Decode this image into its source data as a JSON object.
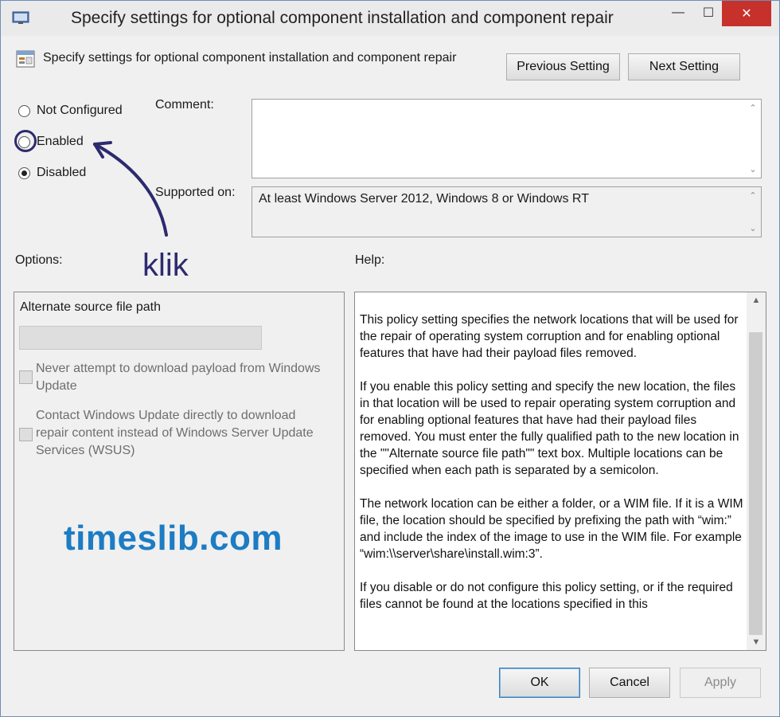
{
  "window": {
    "title": "Specify settings for optional component installation and component repair",
    "controls": {
      "minimize": "—",
      "maximize": "☐",
      "close": "✕"
    }
  },
  "header": {
    "policy_name": "Specify settings for optional component installation and component repair",
    "previous_label": "Previous Setting",
    "next_label": "Next Setting"
  },
  "state": {
    "options": [
      {
        "label": "Not Configured",
        "checked": false
      },
      {
        "label": "Enabled",
        "checked": false
      },
      {
        "label": "Disabled",
        "checked": true
      }
    ]
  },
  "labels": {
    "comment": "Comment:",
    "supported_on": "Supported on:",
    "options": "Options:",
    "help": "Help:"
  },
  "supported_on_value": "At least Windows Server 2012, Windows 8 or Windows RT",
  "options_panel": {
    "alternate_source_label": "Alternate source file path",
    "alternate_source_value": "",
    "checkbox_1": "Never attempt to download payload from Windows Update",
    "checkbox_2": "Contact Windows Update directly to download repair content instead of Windows Server Update Services (WSUS)"
  },
  "help_text": [
    "This policy setting specifies the network locations that will be used for the repair of operating system corruption and for enabling optional features that have had their payload files removed.",
    "If you enable this policy setting and specify the new location, the files in that location will be used to repair operating system corruption and for enabling optional features that have had their payload files removed. You must enter the fully qualified path to the new location in the \"\"Alternate source file path\"\" text box. Multiple locations can be specified when each path is separated by a semicolon.",
    "The network location can be either a folder, or a WIM file. If it is a WIM file, the location should be specified by prefixing the path with “wim:” and include the index of the image to use in the WIM file. For example “wim:\\\\server\\share\\install.wim:3”.",
    "If you disable or do not configure this policy setting, or if the required files cannot be found at the locations specified in this"
  ],
  "footer": {
    "ok": "OK",
    "cancel": "Cancel",
    "apply": "Apply"
  },
  "annotation": {
    "text": "klik",
    "watermark": "timeslib.com",
    "color": "#2d2a6e",
    "watermark_color": "#1c7cc4"
  }
}
